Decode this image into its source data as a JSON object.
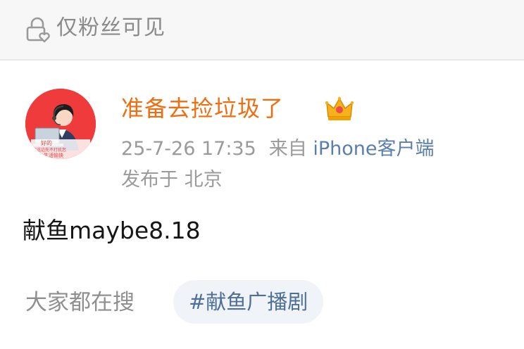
{
  "privacy": {
    "label": "仅粉丝可见",
    "icon": "lock-heart-icon"
  },
  "post": {
    "username": "准备去捡垃圾了",
    "username_color": "#f06d0f",
    "badge_icon": "crown-icon",
    "timestamp": "25-7-26 17:35",
    "source_prefix": "来自",
    "source": "iPhone客户端",
    "source_color": "#5a7fa8",
    "location": "发布于 北京",
    "body": "献鱼maybe8.18",
    "avatar": {
      "icon": "avatar-customer-service-icon",
      "caption_lines": [
        "好的",
        "您这边先不打扰您",
        "生活愉快"
      ]
    }
  },
  "search": {
    "label": "大家都在搜",
    "hashtag": "#献鱼广播剧",
    "hashtag_color": "#4d6f98"
  }
}
